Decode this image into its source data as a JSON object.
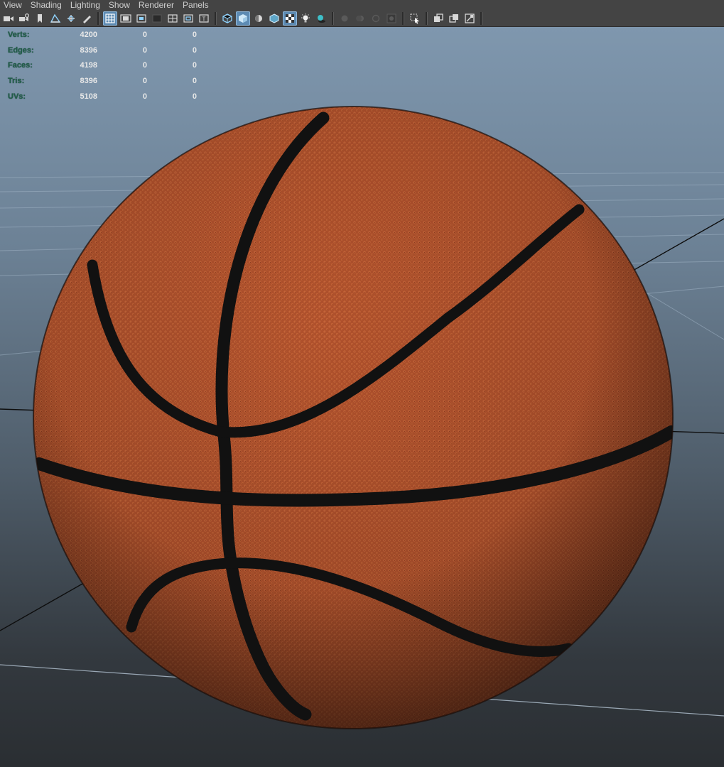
{
  "menubar": {
    "items": [
      "View",
      "Shading",
      "Lighting",
      "Show",
      "Renderer",
      "Panels"
    ]
  },
  "toolbar": {
    "buttons": [
      {
        "icon": "camera-icon"
      },
      {
        "icon": "camera-attributes-icon"
      },
      {
        "icon": "bookmark-icon"
      },
      {
        "icon": "image-plane-icon"
      },
      {
        "icon": "2d-pan-zoom-icon"
      },
      {
        "icon": "grease-pencil-icon"
      },
      {
        "icon": "grid-icon",
        "active": true
      },
      {
        "icon": "film-gate-icon"
      },
      {
        "icon": "resolution-gate-icon"
      },
      {
        "icon": "gate-mask-icon"
      },
      {
        "icon": "field-chart-icon"
      },
      {
        "icon": "safe-action-icon"
      },
      {
        "icon": "safe-title-icon"
      },
      {
        "icon": "wireframe-icon"
      },
      {
        "icon": "smooth-shade-all-icon",
        "active": true
      },
      {
        "icon": "use-default-material-icon"
      },
      {
        "icon": "wireframe-on-shaded-icon"
      },
      {
        "icon": "textured-icon",
        "active": true
      },
      {
        "icon": "use-all-lights-icon"
      },
      {
        "icon": "shadows-icon"
      },
      {
        "icon": "screen-space-ambient-occlusion-icon"
      },
      {
        "icon": "motion-blur-icon"
      },
      {
        "icon": "multisample-anti-aliasing-icon"
      },
      {
        "icon": "depth-of-field-icon"
      },
      {
        "icon": "isolate-select-icon"
      },
      {
        "icon": "xray-icon"
      },
      {
        "icon": "xray-active-components-icon"
      },
      {
        "icon": "xray-joints-icon"
      }
    ]
  },
  "stats": {
    "rows": [
      {
        "label": "Verts:",
        "v1": "4200",
        "v2": "0",
        "v3": "0"
      },
      {
        "label": "Edges:",
        "v1": "8396",
        "v2": "0",
        "v3": "0"
      },
      {
        "label": "Faces:",
        "v1": "4198",
        "v2": "0",
        "v3": "0"
      },
      {
        "label": "Tris:",
        "v1": "8396",
        "v2": "0",
        "v3": "0"
      },
      {
        "label": "UVs:",
        "v1": "5108",
        "v2": "0",
        "v3": "0"
      }
    ]
  },
  "colors": {
    "ball": "#b5532b",
    "seam": "#111111",
    "label_green": "#20604a",
    "ui_bg": "#444444",
    "active_button": "#5d8bb3"
  }
}
